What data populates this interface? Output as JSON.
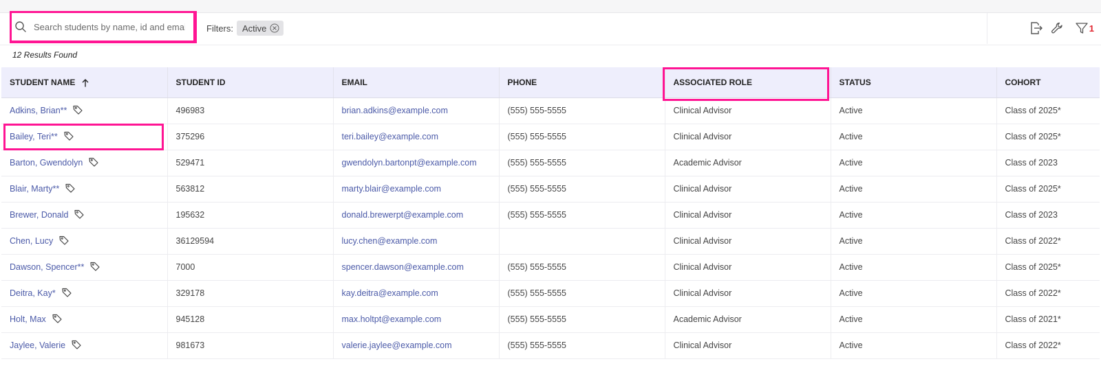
{
  "search": {
    "placeholder": "Search students by name, id and email",
    "value": ""
  },
  "filters": {
    "label": "Filters:",
    "chips": [
      {
        "label": "Active"
      }
    ],
    "active_count": "1"
  },
  "toolbar_icons": [
    "export-icon",
    "wrench-icon",
    "filter-icon"
  ],
  "results": {
    "text": "12 Results Found"
  },
  "table": {
    "columns": [
      {
        "label": "STUDENT NAME",
        "sort": "ascending"
      },
      {
        "label": "STUDENT ID"
      },
      {
        "label": "EMAIL"
      },
      {
        "label": "PHONE"
      },
      {
        "label": "ASSOCIATED ROLE"
      },
      {
        "label": "STATUS"
      },
      {
        "label": "COHORT"
      }
    ],
    "rows": [
      {
        "name": "Adkins, Brian**",
        "id": "496983",
        "email": "brian.adkins@example.com",
        "phone": "(555) 555-5555",
        "role": "Clinical Advisor",
        "status": "Active",
        "cohort": "Class of 2025*"
      },
      {
        "name": "Bailey, Teri**",
        "id": "375296",
        "email": "teri.bailey@example.com",
        "phone": "(555) 555-5555",
        "role": "Clinical Advisor",
        "status": "Active",
        "cohort": "Class of 2025*"
      },
      {
        "name": "Barton, Gwendolyn",
        "id": "529471",
        "email": "gwendolyn.bartonpt@example.com",
        "phone": "(555) 555-5555",
        "role": "Academic Advisor",
        "status": "Active",
        "cohort": "Class of 2023"
      },
      {
        "name": "Blair, Marty**",
        "id": "563812",
        "email": "marty.blair@example.com",
        "phone": "(555) 555-5555",
        "role": "Clinical Advisor",
        "status": "Active",
        "cohort": "Class of 2025*"
      },
      {
        "name": "Brewer, Donald",
        "id": "195632",
        "email": "donald.brewerpt@example.com",
        "phone": "(555) 555-5555",
        "role": "Clinical Advisor",
        "status": "Active",
        "cohort": "Class of 2023"
      },
      {
        "name": "Chen, Lucy",
        "id": "36129594",
        "email": "lucy.chen@example.com",
        "phone": "",
        "role": "Clinical Advisor",
        "status": "Active",
        "cohort": "Class of 2022*"
      },
      {
        "name": "Dawson, Spencer**",
        "id": "7000",
        "email": "spencer.dawson@example.com",
        "phone": "(555) 555-5555",
        "role": "Clinical Advisor",
        "status": "Active",
        "cohort": "Class of 2025*"
      },
      {
        "name": "Deitra, Kay*",
        "id": "329178",
        "email": "kay.deitra@example.com",
        "phone": "(555) 555-5555",
        "role": "Clinical Advisor",
        "status": "Active",
        "cohort": "Class of 2022*"
      },
      {
        "name": "Holt, Max",
        "id": "945128",
        "email": "max.holtpt@example.com",
        "phone": "(555) 555-5555",
        "role": "Academic Advisor",
        "status": "Active",
        "cohort": "Class of 2021*"
      },
      {
        "name": "Jaylee, Valerie",
        "id": "981673",
        "email": "valerie.jaylee@example.com",
        "phone": "(555) 555-5555",
        "role": "Clinical Advisor",
        "status": "Active",
        "cohort": "Class of 2022*"
      }
    ]
  },
  "colors": {
    "highlight": "#ff1493",
    "link": "#4b5aa8",
    "header_bg": "#eeeefc",
    "filter_badge": "#e0242e"
  }
}
